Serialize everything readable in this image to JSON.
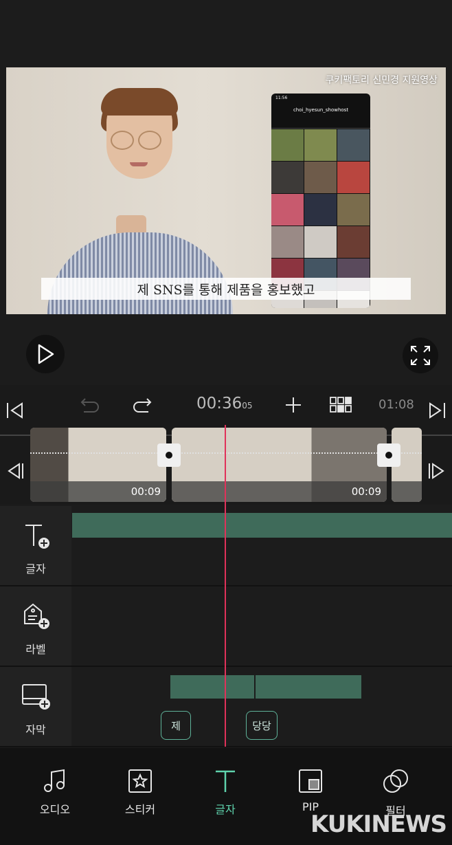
{
  "preview": {
    "watermark": "쿠키팩토리 신민경 지원영상",
    "subtitle": "제 SNS를 통해 제품을 홍보했고",
    "phone": {
      "status_time": "11:56",
      "username": "choi_hyesun_showhost"
    }
  },
  "toolbar": {
    "current_time_main": "00:36",
    "current_time_frames": "05",
    "total_time": "01:08"
  },
  "timeline": {
    "clips": [
      {
        "duration": "00:09"
      },
      {
        "duration": "00:09"
      }
    ]
  },
  "tracks": [
    {
      "label": "글자",
      "icon": "text-add-icon"
    },
    {
      "label": "라벨",
      "icon": "label-add-icon"
    },
    {
      "label": "자막",
      "icon": "subtitle-add-icon"
    }
  ],
  "subtitle_tags": [
    "제",
    "당당"
  ],
  "bottom_nav": [
    {
      "label": "오디오",
      "icon": "music-note-icon"
    },
    {
      "label": "스티커",
      "icon": "sticker-star-icon"
    },
    {
      "label": "글자",
      "icon": "text-icon",
      "active": true
    },
    {
      "label": "PIP",
      "icon": "pip-icon"
    },
    {
      "label": "필터",
      "icon": "filter-icon"
    }
  ],
  "brand": {
    "logo": "KUKINEWS"
  },
  "colors": {
    "accent": "#5fd3ad",
    "playhead": "#e0325a",
    "track_bar": "#3f6b5a"
  }
}
